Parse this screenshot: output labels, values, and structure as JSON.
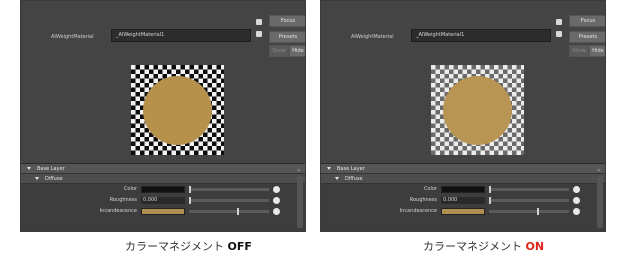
{
  "panels": [
    {
      "material_label": "AIWeightMaterial",
      "material_name": "_AIWeightMaterial1",
      "buttons": {
        "focus": "Focus",
        "presets": "Presets",
        "show": "Show",
        "hide": "Hide"
      },
      "sections": {
        "base_layer": "Base Layer",
        "diffuse": "Diffuse"
      },
      "rows": {
        "color_label": "Color",
        "roughness_label": "Roughness",
        "roughness_value": "0.000",
        "incandescence_label": "Incandescence"
      },
      "caption": {
        "text": "カラーマネジメント",
        "state": "OFF"
      }
    },
    {
      "material_label": "AIWeightMaterial",
      "material_name": "_AIWeightMaterial1",
      "buttons": {
        "focus": "Focus",
        "presets": "Presets",
        "show": "Show",
        "hide": "Hide"
      },
      "sections": {
        "base_layer": "Base Layer",
        "diffuse": "Diffuse"
      },
      "rows": {
        "color_label": "Color",
        "roughness_label": "Roughness",
        "roughness_value": "0.000",
        "incandescence_label": "Incandescence"
      },
      "caption": {
        "text": "カラーマネジメント",
        "state": "ON"
      }
    }
  ],
  "colors": {
    "panel_bg": "#444444",
    "sphere_off": "#b5914c",
    "sphere_on": "#b99554",
    "state_on": "#e0221b",
    "state_off": "#111111"
  },
  "icons": [
    "up-arrow-icon",
    "down-arrow-icon",
    "texture-map-icon",
    "collapse-triangle-icon"
  ]
}
